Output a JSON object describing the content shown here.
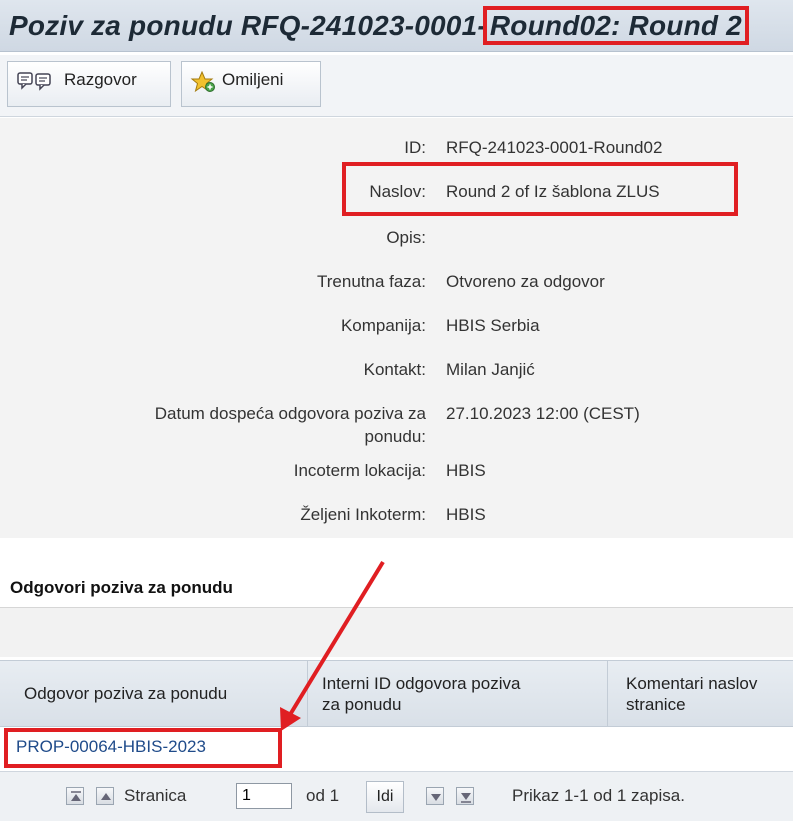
{
  "title": {
    "prefix": "Poziv za ponudu RFQ-241023-0001-",
    "highlight": "Round02: Round 2"
  },
  "toolbar": {
    "conversation_label": "Razgovor",
    "favorites_label": "Omiljeni"
  },
  "details": {
    "id_label": "ID:",
    "id_value": "RFQ-241023-0001-Round02",
    "title_label": "Naslov:",
    "title_value": "Round 2 of Iz šablona ZLUS",
    "desc_label": "Opis:",
    "desc_value": "",
    "phase_label": "Trenutna faza:",
    "phase_value": "Otvoreno za odgovor",
    "company_label": "Kompanija:",
    "company_value": "HBIS Serbia",
    "contact_label": "Kontakt:",
    "contact_value": "Milan Janjić",
    "due_label_line1": "Datum dospeća odgovora poziva za",
    "due_label_line2": "ponudu:",
    "due_value": "27.10.2023 12:00 (CEST)",
    "incoterm_loc_label": "Incoterm lokacija:",
    "incoterm_loc_value": "HBIS",
    "incoterm_label": "Željeni Inkoterm:",
    "incoterm_value": "HBIS"
  },
  "responses": {
    "section_title": "Odgovori poziva za ponudu",
    "columns": [
      {
        "line1": "Odgovor poziva za ponudu",
        "line2": ""
      },
      {
        "line1": "Interni ID odgovora poziva",
        "line2": "za ponudu"
      },
      {
        "line1": "Komentari naslov",
        "line2": "stranice"
      }
    ],
    "rows": [
      {
        "response": "PROP-00064-HBIS-2023"
      }
    ]
  },
  "pager": {
    "page_label": "Stranica",
    "page_value": "1",
    "of_label": "od 1",
    "go_label": "Idi",
    "summary": "Prikaz 1-1 od 1 zapisa."
  },
  "colors": {
    "highlight": "#e01e22",
    "link": "#1f4b8a"
  }
}
